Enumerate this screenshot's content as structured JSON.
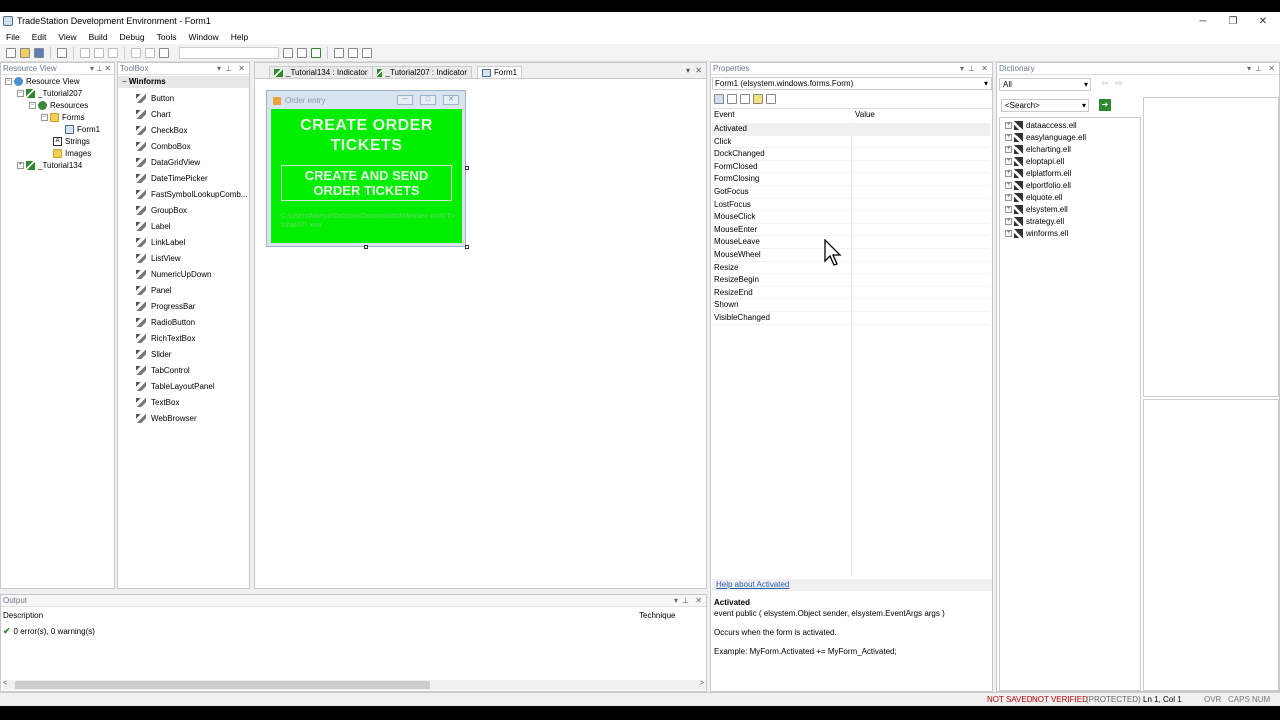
{
  "window": {
    "title": "TradeStation Development Environment - Form1",
    "min": "─",
    "max": "❐",
    "close": "✕"
  },
  "menu": [
    "File",
    "Edit",
    "View",
    "Build",
    "Debug",
    "Tools",
    "Window",
    "Help"
  ],
  "resource_view": {
    "header": "Resource View",
    "items": [
      {
        "label": "Resource View",
        "icon": "resource-view-icon"
      },
      {
        "label": "_Tutorial207",
        "icon": "project-icon"
      },
      {
        "label": "Resources",
        "icon": "resources-icon"
      },
      {
        "label": "Forms",
        "icon": "folder-icon"
      },
      {
        "label": "Form1",
        "icon": "form-icon"
      },
      {
        "label": "Strings",
        "icon": "strings-icon"
      },
      {
        "label": "Images",
        "icon": "folder-icon"
      },
      {
        "label": "_Tutorial134",
        "icon": "project-icon"
      }
    ]
  },
  "toolbox": {
    "header": "ToolBox",
    "section": "Winforms",
    "items": [
      "Button",
      "Chart",
      "CheckBox",
      "ComboBox",
      "DataGridView",
      "DateTimePicker",
      "FastSymbolLookupComb...",
      "GroupBox",
      "Label",
      "LinkLabel",
      "ListView",
      "NumericUpDown",
      "Panel",
      "ProgressBar",
      "RadioButton",
      "RichTextBox",
      "Slider",
      "TabControl",
      "TableLayoutPanel",
      "TextBox",
      "WebBrowser"
    ]
  },
  "editor": {
    "tabs": [
      "_Tutorial134 : Indicator",
      "_Tutorial207 : Indicator",
      "Form1"
    ],
    "form": {
      "title": "Order entry",
      "heading": "CREATE ORDER TICKETS",
      "button": "CREATE AND SEND ORDER TICKETS",
      "path": "C:\\Users\\Martyn\\Dropbox\\Documents\\Markplex work\\Tutorial207.xlsx"
    }
  },
  "properties": {
    "header": "Properties",
    "object": "Form1 (elsystem.windows.forms.Form)",
    "columns": {
      "event": "Event",
      "value": "Value"
    },
    "events": [
      "Activated",
      "Click",
      "DockChanged",
      "FormClosed",
      "FormClosing",
      "GotFocus",
      "LostFocus",
      "MouseClick",
      "MouseEnter",
      "MouseLeave",
      "MouseWheel",
      "Resize",
      "ResizeBegin",
      "ResizeEnd",
      "Shown",
      "VisibleChanged"
    ],
    "help_link": "Help about Activated",
    "help_title": "Activated",
    "help_sig": "event public ( elsystem.Object sender, elsystem.EventArgs args )",
    "help_desc": "Occurs when the form is activated.",
    "help_example": "Example: MyForm.Activated += MyForm_Activated;"
  },
  "dictionary": {
    "header": "Dictionary",
    "filter": "All",
    "search": "<Search>",
    "items": [
      "dataaccess.ell",
      "easylanguage.ell",
      "elcharting.ell",
      "eloptapi.ell",
      "elplatform.ell",
      "elportfolio.ell",
      "elquote.ell",
      "elsystem.ell",
      "strategy.ell",
      "winforms.ell"
    ]
  },
  "output": {
    "header": "Output",
    "col_description": "Description",
    "col_technique": "Technique",
    "message": "0 error(s), 0 warning(s)"
  },
  "status": {
    "not_saved": "NOT SAVED",
    "not_verified": "NOT VERIFIED",
    "protected": "(PROTECTED)",
    "position": "Ln 1, Col 1",
    "ovr": "OVR",
    "caps": "CAPS",
    "num": "NUM"
  }
}
